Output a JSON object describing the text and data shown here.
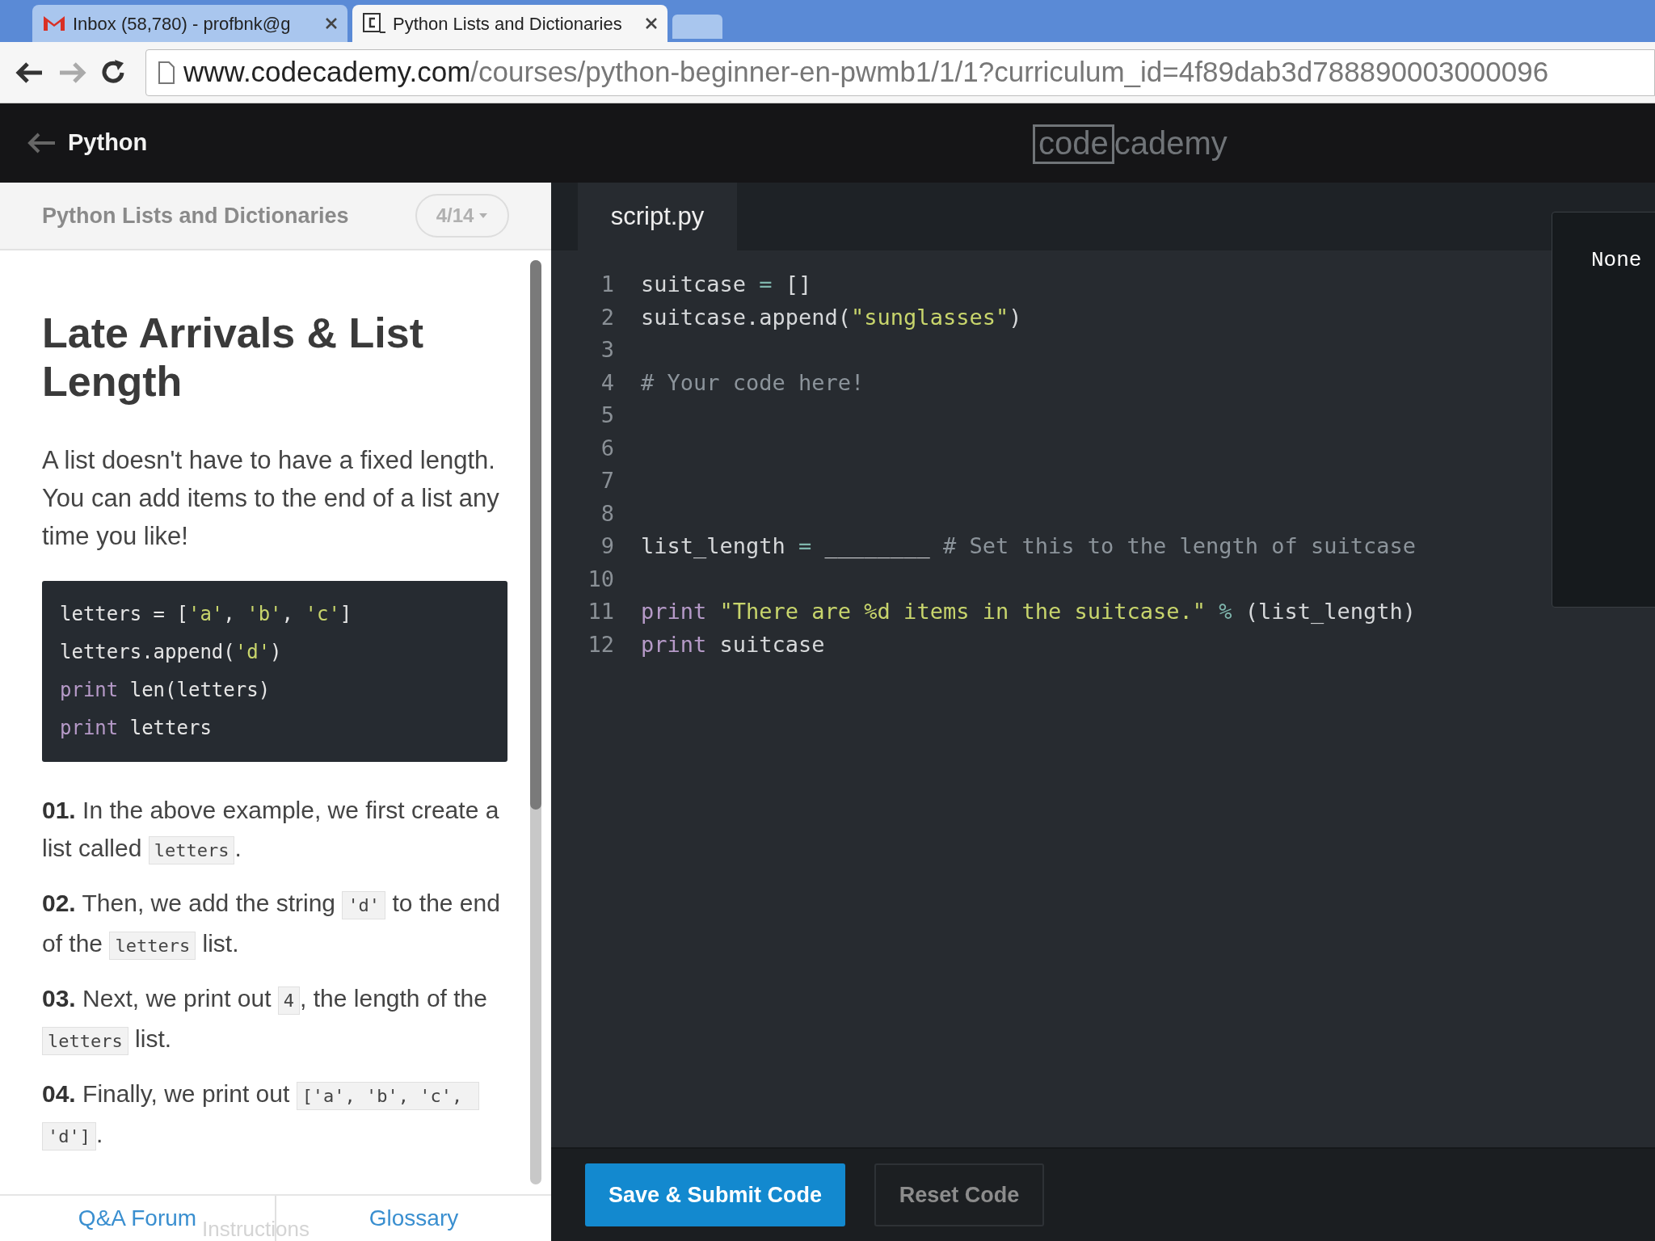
{
  "browser": {
    "tabs": [
      {
        "title": "Inbox (58,780) - profbnk@g",
        "kind": "mail",
        "selected": false
      },
      {
        "title": "Python Lists and Dictionaries",
        "kind": "site",
        "selected": true
      }
    ],
    "address": {
      "host": "www.codecademy.com",
      "path": "/courses/python-beginner-en-pwmb1/1/1?curriculum_id=4f89dab3d788890003000096"
    }
  },
  "header": {
    "course": "Python",
    "logo": {
      "boxed": "code",
      "rest": "cademy"
    }
  },
  "lesson": {
    "unit": "Python Lists and Dictionaries",
    "progress": "4/14",
    "title": "Late Arrivals & List Length",
    "intro": "A list doesn't have to have a fixed length. You can add items to the end of a list any time you like!",
    "example": [
      {
        "tokens": [
          {
            "kind": "plain",
            "text": "letters = ["
          },
          {
            "kind": "str",
            "text": "'a'"
          },
          {
            "kind": "plain",
            "text": ", "
          },
          {
            "kind": "str",
            "text": "'b'"
          },
          {
            "kind": "plain",
            "text": ", "
          },
          {
            "kind": "str",
            "text": "'c'"
          },
          {
            "kind": "plain",
            "text": "]"
          }
        ]
      },
      {
        "tokens": [
          {
            "kind": "plain",
            "text": "letters.append("
          },
          {
            "kind": "str",
            "text": "'d'"
          },
          {
            "kind": "plain",
            "text": ")"
          }
        ]
      },
      {
        "tokens": [
          {
            "kind": "kw",
            "text": "print"
          },
          {
            "kind": "plain",
            "text": " len(letters)"
          }
        ]
      },
      {
        "tokens": [
          {
            "kind": "kw",
            "text": "print"
          },
          {
            "kind": "plain",
            "text": " letters"
          }
        ]
      }
    ],
    "steps": [
      {
        "number": "01.",
        "parts": [
          {
            "kind": "text",
            "text": "In the above example, we first create a list called "
          },
          {
            "kind": "code",
            "text": "letters"
          },
          {
            "kind": "text",
            "text": "."
          }
        ]
      },
      {
        "number": "02.",
        "parts": [
          {
            "kind": "text",
            "text": "Then, we add the string "
          },
          {
            "kind": "code",
            "text": "'d'"
          },
          {
            "kind": "text",
            "text": " to the end of the "
          },
          {
            "kind": "code",
            "text": "letters"
          },
          {
            "kind": "text",
            "text": " list."
          }
        ]
      },
      {
        "number": "03.",
        "parts": [
          {
            "kind": "text",
            "text": "Next, we print out "
          },
          {
            "kind": "code",
            "text": "4"
          },
          {
            "kind": "text",
            "text": ", the length of the "
          },
          {
            "kind": "code",
            "text": "letters"
          },
          {
            "kind": "text",
            "text": " list."
          }
        ]
      },
      {
        "number": "04.",
        "parts": [
          {
            "kind": "text",
            "text": "Finally, we print out "
          },
          {
            "kind": "code",
            "text": "['a', 'b', 'c', 'd']"
          },
          {
            "kind": "text",
            "text": "."
          }
        ]
      }
    ],
    "footer": {
      "left": "Q&A Forum",
      "middle": "Instructions",
      "right": "Glossary"
    }
  },
  "editor": {
    "file": "script.py",
    "lines": [
      {
        "number": "1",
        "tokens": [
          {
            "kind": "plain",
            "text": "suitcase "
          },
          {
            "kind": "op",
            "text": "="
          },
          {
            "kind": "plain",
            "text": " []"
          }
        ]
      },
      {
        "number": "2",
        "tokens": [
          {
            "kind": "plain",
            "text": "suitcase.append("
          },
          {
            "kind": "str",
            "text": "\"sunglasses\""
          },
          {
            "kind": "plain",
            "text": ")"
          }
        ]
      },
      {
        "number": "3"
      },
      {
        "number": "4",
        "tokens": [
          {
            "kind": "comment",
            "text": "# Your code here!"
          }
        ]
      },
      {
        "number": "5"
      },
      {
        "number": "6"
      },
      {
        "number": "7"
      },
      {
        "number": "8"
      },
      {
        "number": "9",
        "tokens": [
          {
            "kind": "plain",
            "text": "list_length "
          },
          {
            "kind": "op",
            "text": "="
          },
          {
            "kind": "plain",
            "text": " ________ "
          },
          {
            "kind": "comment",
            "text": "# Set this to the length of suitcase"
          }
        ]
      },
      {
        "number": "10"
      },
      {
        "number": "11",
        "tokens": [
          {
            "kind": "kw",
            "text": "print "
          },
          {
            "kind": "str",
            "text": "\"There are %d items in the suitcase.\" "
          },
          {
            "kind": "op",
            "text": "%"
          },
          {
            "kind": "plain",
            "text": " (list_length)"
          }
        ]
      },
      {
        "number": "12",
        "tokens": [
          {
            "kind": "kw",
            "text": "print"
          },
          {
            "kind": "plain",
            "text": " suitcase"
          }
        ]
      }
    ],
    "output": "None"
  },
  "buttons": {
    "submit": "Save & Submit Code",
    "reset": "Reset Code"
  }
}
